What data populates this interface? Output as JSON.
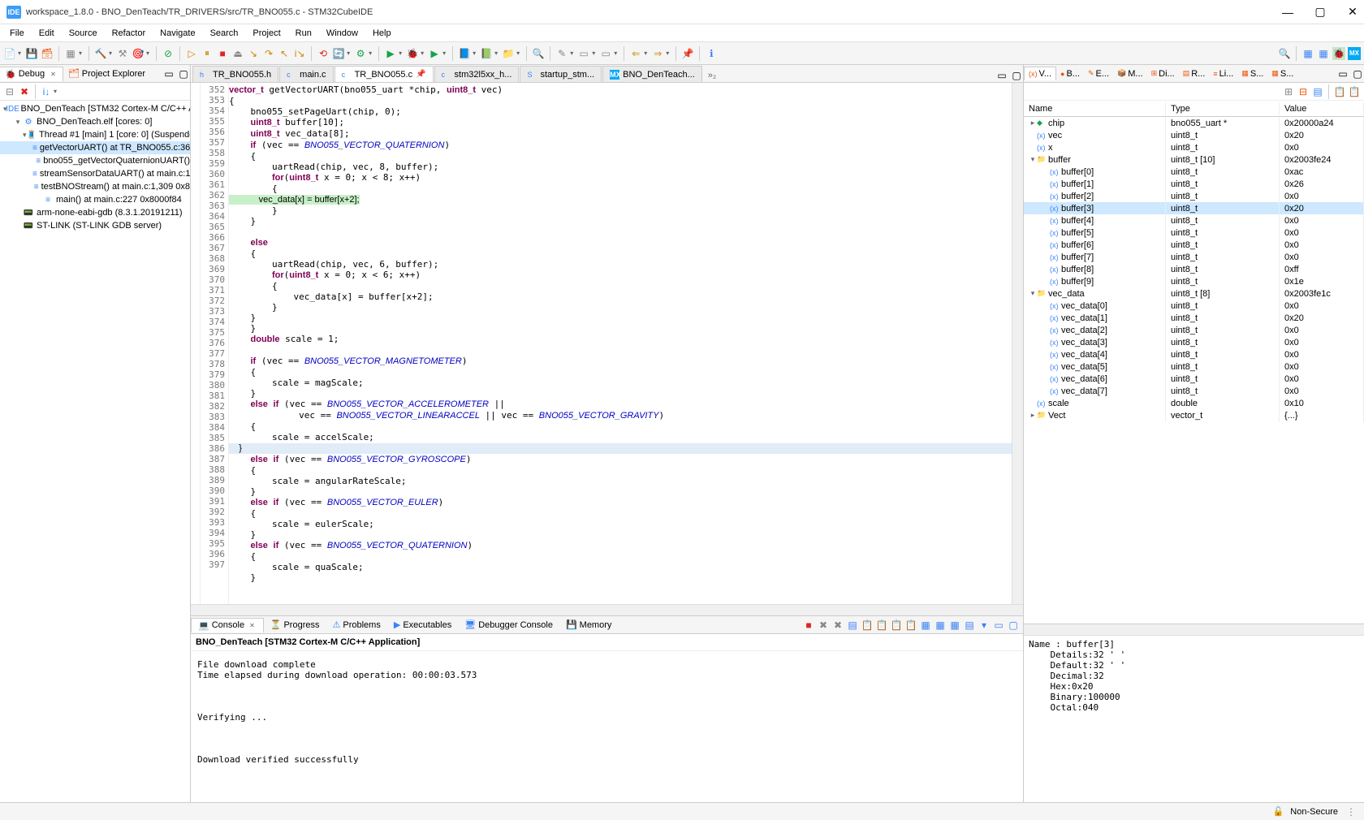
{
  "window": {
    "title": "workspace_1.8.0 - BNO_DenTeach/TR_DRIVERS/src/TR_BNO055.c - STM32CubeIDE",
    "ide_badge": "IDE"
  },
  "menu": [
    "File",
    "Edit",
    "Source",
    "Refactor",
    "Navigate",
    "Search",
    "Project",
    "Run",
    "Window",
    "Help"
  ],
  "left_panel": {
    "tabs": [
      {
        "label": "Debug",
        "active": true
      },
      {
        "label": "Project Explorer",
        "active": false
      }
    ],
    "tree": [
      {
        "lvl": 0,
        "exp": "▾",
        "icon": "IDE",
        "label": "BNO_DenTeach [STM32 Cortex-M C/C++ Ap"
      },
      {
        "lvl": 1,
        "exp": "▾",
        "icon": "⚙",
        "label": "BNO_DenTeach.elf [cores: 0]"
      },
      {
        "lvl": 2,
        "exp": "▾",
        "icon": "🧵",
        "label": "Thread #1 [main] 1 [core: 0] (Suspende"
      },
      {
        "lvl": 3,
        "exp": "",
        "icon": "≡",
        "label": "getVectorUART() at TR_BNO055.c:36",
        "sel": true
      },
      {
        "lvl": 3,
        "exp": "",
        "icon": "≡",
        "label": "bno055_getVectorQuaternionUART()"
      },
      {
        "lvl": 3,
        "exp": "",
        "icon": "≡",
        "label": "streamSensorDataUART() at main.c:1"
      },
      {
        "lvl": 3,
        "exp": "",
        "icon": "≡",
        "label": "testBNOStream() at main.c:1,309 0x8"
      },
      {
        "lvl": 3,
        "exp": "",
        "icon": "≡",
        "label": "main() at main.c:227 0x8000f84"
      },
      {
        "lvl": 1,
        "exp": "",
        "icon": "📟",
        "label": "arm-none-eabi-gdb (8.3.1.20191211)"
      },
      {
        "lvl": 1,
        "exp": "",
        "icon": "📟",
        "label": "ST-LINK (ST-LINK GDB server)"
      }
    ]
  },
  "editor": {
    "tabs": [
      {
        "label": "TR_BNO055.h",
        "icon": "h",
        "active": false
      },
      {
        "label": "main.c",
        "icon": "c",
        "active": false
      },
      {
        "label": "TR_BNO055.c",
        "icon": "c",
        "active": true,
        "pinned": true
      },
      {
        "label": "stm32l5xx_h...",
        "icon": "c",
        "active": false
      },
      {
        "label": "startup_stm...",
        "icon": "S",
        "active": false
      },
      {
        "label": "BNO_DenTeach...",
        "icon": "MX",
        "active": false
      }
    ],
    "overflow": "»₂",
    "first_line": 352,
    "highlight_line": 362,
    "current_line": 385,
    "code_lines": [
      "vector_t getVectorUART(bno055_uart *chip, uint8_t vec)",
      "{",
      "    bno055_setPageUart(chip, 0);",
      "    uint8_t buffer[10];",
      "    uint8_t vec_data[8];",
      "    if (vec == BNO055_VECTOR_QUATERNION)",
      "    {",
      "        uartRead(chip, vec, 8, buffer);",
      "        for(uint8_t x = 0; x < 8; x++)",
      "        {",
      "            vec_data[x] = buffer[x+2];",
      "        }",
      "    }",
      "",
      "    else",
      "    {",
      "        uartRead(chip, vec, 6, buffer);",
      "        for(uint8_t x = 0; x < 6; x++)",
      "        {",
      "            vec_data[x] = buffer[x+2];",
      "        }",
      "    }",
      "    }",
      "    double scale = 1;",
      "",
      "    if (vec == BNO055_VECTOR_MAGNETOMETER)",
      "    {",
      "        scale = magScale;",
      "    }",
      "    else if (vec == BNO055_VECTOR_ACCELEROMETER ||",
      "             vec == BNO055_VECTOR_LINEARACCEL || vec == BNO055_VECTOR_GRAVITY)",
      "    {",
      "        scale = accelScale;",
      "    }",
      "    else if (vec == BNO055_VECTOR_GYROSCOPE)",
      "    {",
      "        scale = angularRateScale;",
      "    }",
      "    else if (vec == BNO055_VECTOR_EULER)",
      "    {",
      "        scale = eulerScale;",
      "    }",
      "    else if (vec == BNO055_VECTOR_QUATERNION)",
      "    {",
      "        scale = quaScale;",
      "    }"
    ]
  },
  "bottom": {
    "tabs": [
      {
        "label": "Console",
        "active": true
      },
      {
        "label": "Progress",
        "active": false
      },
      {
        "label": "Problems",
        "active": false
      },
      {
        "label": "Executables",
        "active": false
      },
      {
        "label": "Debugger Console",
        "active": false
      },
      {
        "label": "Memory",
        "active": false
      }
    ],
    "header": "BNO_DenTeach [STM32 Cortex-M C/C++ Application]",
    "text": "File download complete\nTime elapsed during download operation: 00:00:03.573\n\n\n\nVerifying ...\n\n\n\nDownload verified successfully\n"
  },
  "variables": {
    "tabs": [
      "V...",
      "B...",
      "E...",
      "M...",
      "Di...",
      "R...",
      "Li...",
      "S...",
      "S..."
    ],
    "columns": [
      "Name",
      "Type",
      "Value"
    ],
    "rows": [
      {
        "lvl": 0,
        "exp": "▸",
        "icon": "◆",
        "name": "chip",
        "type": "bno055_uart *",
        "value": "0x20000a24"
      },
      {
        "lvl": 0,
        "exp": "",
        "icon": "(x)",
        "name": "vec",
        "type": "uint8_t",
        "value": "0x20"
      },
      {
        "lvl": 0,
        "exp": "",
        "icon": "(x)",
        "name": "x",
        "type": "uint8_t",
        "value": "0x0"
      },
      {
        "lvl": 0,
        "exp": "▾",
        "icon": "📁",
        "name": "buffer",
        "type": "uint8_t [10]",
        "value": "0x2003fe24"
      },
      {
        "lvl": 1,
        "exp": "",
        "icon": "(x)",
        "name": "buffer[0]",
        "type": "uint8_t",
        "value": "0xac"
      },
      {
        "lvl": 1,
        "exp": "",
        "icon": "(x)",
        "name": "buffer[1]",
        "type": "uint8_t",
        "value": "0x26"
      },
      {
        "lvl": 1,
        "exp": "",
        "icon": "(x)",
        "name": "buffer[2]",
        "type": "uint8_t",
        "value": "0x0"
      },
      {
        "lvl": 1,
        "exp": "",
        "icon": "(x)",
        "name": "buffer[3]",
        "type": "uint8_t",
        "value": "0x20",
        "sel": true
      },
      {
        "lvl": 1,
        "exp": "",
        "icon": "(x)",
        "name": "buffer[4]",
        "type": "uint8_t",
        "value": "0x0"
      },
      {
        "lvl": 1,
        "exp": "",
        "icon": "(x)",
        "name": "buffer[5]",
        "type": "uint8_t",
        "value": "0x0"
      },
      {
        "lvl": 1,
        "exp": "",
        "icon": "(x)",
        "name": "buffer[6]",
        "type": "uint8_t",
        "value": "0x0"
      },
      {
        "lvl": 1,
        "exp": "",
        "icon": "(x)",
        "name": "buffer[7]",
        "type": "uint8_t",
        "value": "0x0"
      },
      {
        "lvl": 1,
        "exp": "",
        "icon": "(x)",
        "name": "buffer[8]",
        "type": "uint8_t",
        "value": "0xff"
      },
      {
        "lvl": 1,
        "exp": "",
        "icon": "(x)",
        "name": "buffer[9]",
        "type": "uint8_t",
        "value": "0x1e"
      },
      {
        "lvl": 0,
        "exp": "▾",
        "icon": "📁",
        "name": "vec_data",
        "type": "uint8_t [8]",
        "value": "0x2003fe1c"
      },
      {
        "lvl": 1,
        "exp": "",
        "icon": "(x)",
        "name": "vec_data[0]",
        "type": "uint8_t",
        "value": "0x0"
      },
      {
        "lvl": 1,
        "exp": "",
        "icon": "(x)",
        "name": "vec_data[1]",
        "type": "uint8_t",
        "value": "0x20"
      },
      {
        "lvl": 1,
        "exp": "",
        "icon": "(x)",
        "name": "vec_data[2]",
        "type": "uint8_t",
        "value": "0x0"
      },
      {
        "lvl": 1,
        "exp": "",
        "icon": "(x)",
        "name": "vec_data[3]",
        "type": "uint8_t",
        "value": "0x0"
      },
      {
        "lvl": 1,
        "exp": "",
        "icon": "(x)",
        "name": "vec_data[4]",
        "type": "uint8_t",
        "value": "0x0"
      },
      {
        "lvl": 1,
        "exp": "",
        "icon": "(x)",
        "name": "vec_data[5]",
        "type": "uint8_t",
        "value": "0x0"
      },
      {
        "lvl": 1,
        "exp": "",
        "icon": "(x)",
        "name": "vec_data[6]",
        "type": "uint8_t",
        "value": "0x0"
      },
      {
        "lvl": 1,
        "exp": "",
        "icon": "(x)",
        "name": "vec_data[7]",
        "type": "uint8_t",
        "value": "0x0"
      },
      {
        "lvl": 0,
        "exp": "",
        "icon": "(x)",
        "name": "scale",
        "type": "double",
        "value": "0x10"
      },
      {
        "lvl": 0,
        "exp": "▸",
        "icon": "📁",
        "name": "Vect",
        "type": "vector_t",
        "value": "{...}"
      }
    ],
    "detail": "Name : buffer[3]\n    Details:32 ' '\n    Default:32 ' '\n    Decimal:32\n    Hex:0x20\n    Binary:100000\n    Octal:040"
  },
  "statusbar": {
    "security": "Non-Secure"
  }
}
